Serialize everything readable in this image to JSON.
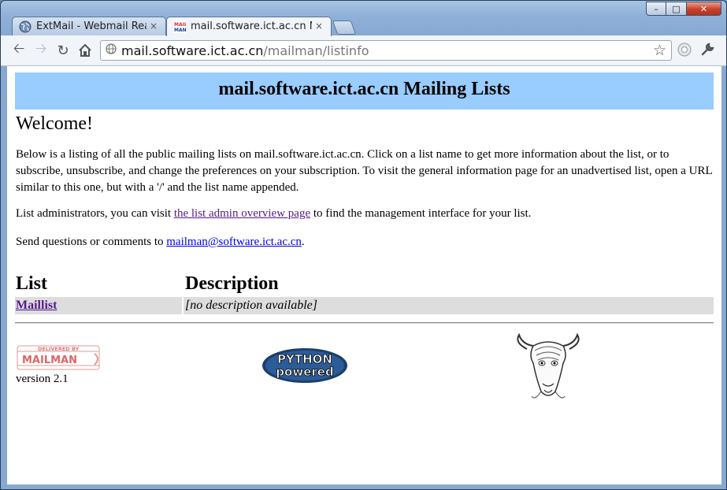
{
  "browser": {
    "tabs": [
      {
        "title": "ExtMail - Webmail Read",
        "active": false
      },
      {
        "title": "mail.software.ict.ac.cn Ma",
        "active": true
      }
    ],
    "close_glyph": "×",
    "url_host": "mail.software.ict.ac.cn",
    "url_path": "/mailman/listinfo",
    "favicon_text": "MAIL MAN"
  },
  "page": {
    "heading": "mail.software.ict.ac.cn Mailing Lists",
    "welcome": "Welcome!",
    "intro": "Below is a listing of all the public mailing lists on mail.software.ict.ac.cn. Click on a list name to get more information about the list, or to subscribe, unsubscribe, and change the preferences on your subscription. To visit the general information page for an unadvertised list, open a URL similar to this one, but with a '/' and the list name appended.",
    "admin_prefix": "List administrators, you can visit ",
    "admin_link": "the list admin overview page",
    "admin_suffix": " to find the management interface for your list.",
    "questions_prefix": "Send questions or comments to ",
    "questions_email": "mailman@software.ict.ac.cn",
    "questions_suffix": ".",
    "table": {
      "headers": [
        "List",
        "Description"
      ],
      "rows": [
        {
          "name": "Maillist",
          "description": "[no description available]"
        }
      ]
    },
    "footer": {
      "mailman_logo_text": [
        "DELIVERED BY",
        "MAILMAN"
      ],
      "version": "version 2.1",
      "python_logo_text": [
        "PYTHON",
        "powered"
      ]
    }
  },
  "colors": {
    "banner": "#99ccff",
    "visited_link": "#551a8b",
    "link": "#0000ee",
    "row_bg": "#dddddd"
  }
}
